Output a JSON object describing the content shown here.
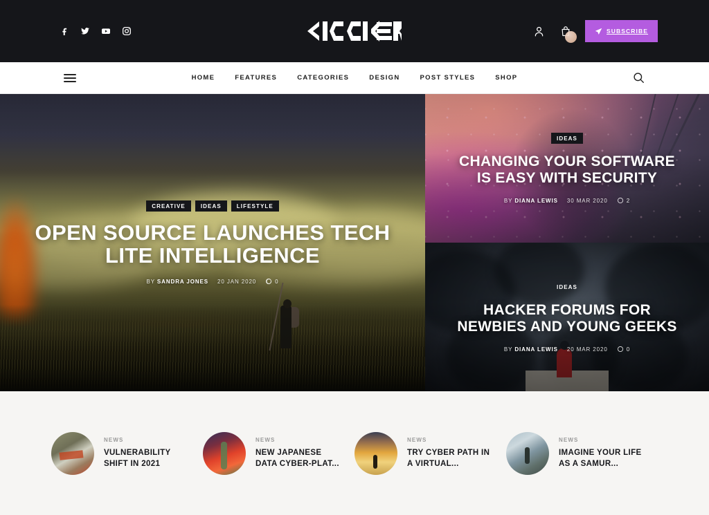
{
  "topbar": {
    "social": [
      {
        "name": "facebook-icon",
        "label": "Facebook"
      },
      {
        "name": "twitter-icon",
        "label": "Twitter"
      },
      {
        "name": "youtube-icon",
        "label": "YouTube"
      },
      {
        "name": "instagram-icon",
        "label": "Instagram"
      }
    ],
    "logo_text": "KICKER",
    "account_label": "Account",
    "cart_label": "Cart",
    "subscribe_label": "SUBSCRIBE",
    "accent_color": "#b45ce0",
    "background_color": "#15161a"
  },
  "nav": {
    "menu_toggle_label": "Menu",
    "search_label": "Search",
    "items": [
      {
        "label": "HOME"
      },
      {
        "label": "FEATURES"
      },
      {
        "label": "CATEGORIES"
      },
      {
        "label": "DESIGN"
      },
      {
        "label": "POST STYLES"
      },
      {
        "label": "SHOP"
      }
    ]
  },
  "hero": {
    "main": {
      "tags": [
        "CREATIVE",
        "IDEAS",
        "LIFESTYLE"
      ],
      "title": "OPEN SOURCE LAUNCHES TECH LITE INTELLIGENCE",
      "by_label": "BY",
      "author": "SANDRA JONES",
      "date": "20 JAN 2020",
      "comments": "0"
    },
    "side": [
      {
        "tags": [
          "IDEAS"
        ],
        "title": "CHANGING YOUR SOFTWARE IS EASY WITH SECURITY",
        "by_label": "BY",
        "author": "DIANA LEWIS",
        "date": "30 MAR 2020",
        "comments": "2"
      },
      {
        "tags": [
          "IDEAS"
        ],
        "title": "HACKER FORUMS FOR NEWBIES AND YOUNG GEEKS",
        "by_label": "BY",
        "author": "DIANA LEWIS",
        "date": "20 MAR 2020",
        "comments": "0"
      }
    ]
  },
  "strip": {
    "items": [
      {
        "category": "NEWS",
        "title": "VULNERABILITY SHIFT IN 2021"
      },
      {
        "category": "NEWS",
        "title": "NEW JAPANESE DATA CYBER-PLAT..."
      },
      {
        "category": "NEWS",
        "title": "TRY CYBER PATH IN A VIRTUAL..."
      },
      {
        "category": "NEWS",
        "title": "IMAGINE YOUR LIFE AS A SAMUR..."
      }
    ]
  }
}
